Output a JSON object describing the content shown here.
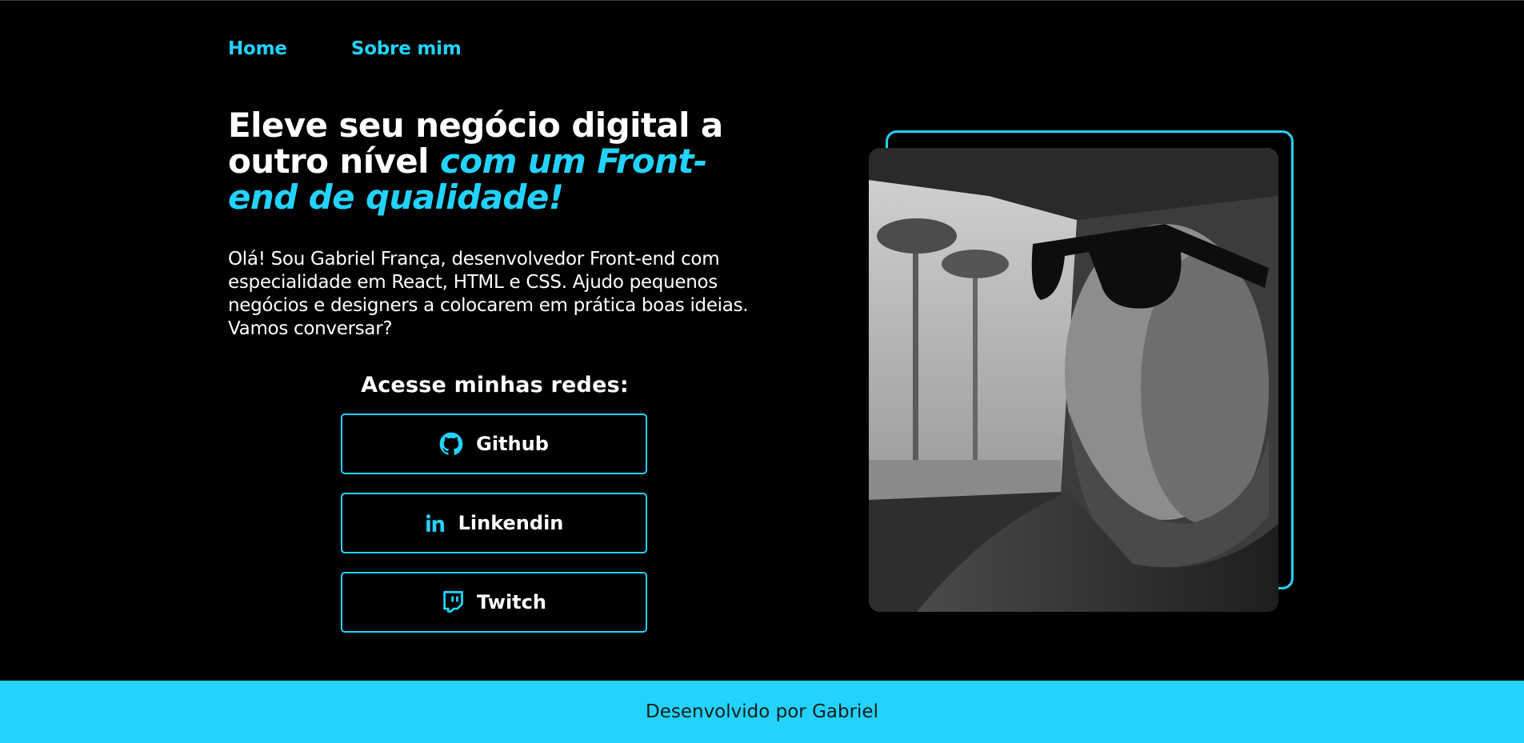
{
  "nav": {
    "items": [
      {
        "label": "Home"
      },
      {
        "label": "Sobre mim"
      }
    ]
  },
  "hero": {
    "headline_plain": "Eleve seu negócio digital a outro nível ",
    "headline_accent": "com um Front-end de qualidade!",
    "intro": "Olá! Sou Gabriel França, desenvolvedor Front-end com especialidade em React, HTML e CSS. Ajudo pequenos negócios e designers a colocarem em prática boas ideias. Vamos conversar?"
  },
  "social": {
    "title": "Acesse minhas redes:",
    "buttons": [
      {
        "label": "Github",
        "icon": "github-icon"
      },
      {
        "label": "Linkendin",
        "icon": "linkedin-icon"
      },
      {
        "label": "Twitch",
        "icon": "twitch-icon"
      }
    ]
  },
  "footer": {
    "text": "Desenvolvido por Gabriel"
  },
  "colors": {
    "background": "#000000",
    "accent": "#22d3ff",
    "text": "#ffffff",
    "footer_text": "#1a1a1a"
  }
}
